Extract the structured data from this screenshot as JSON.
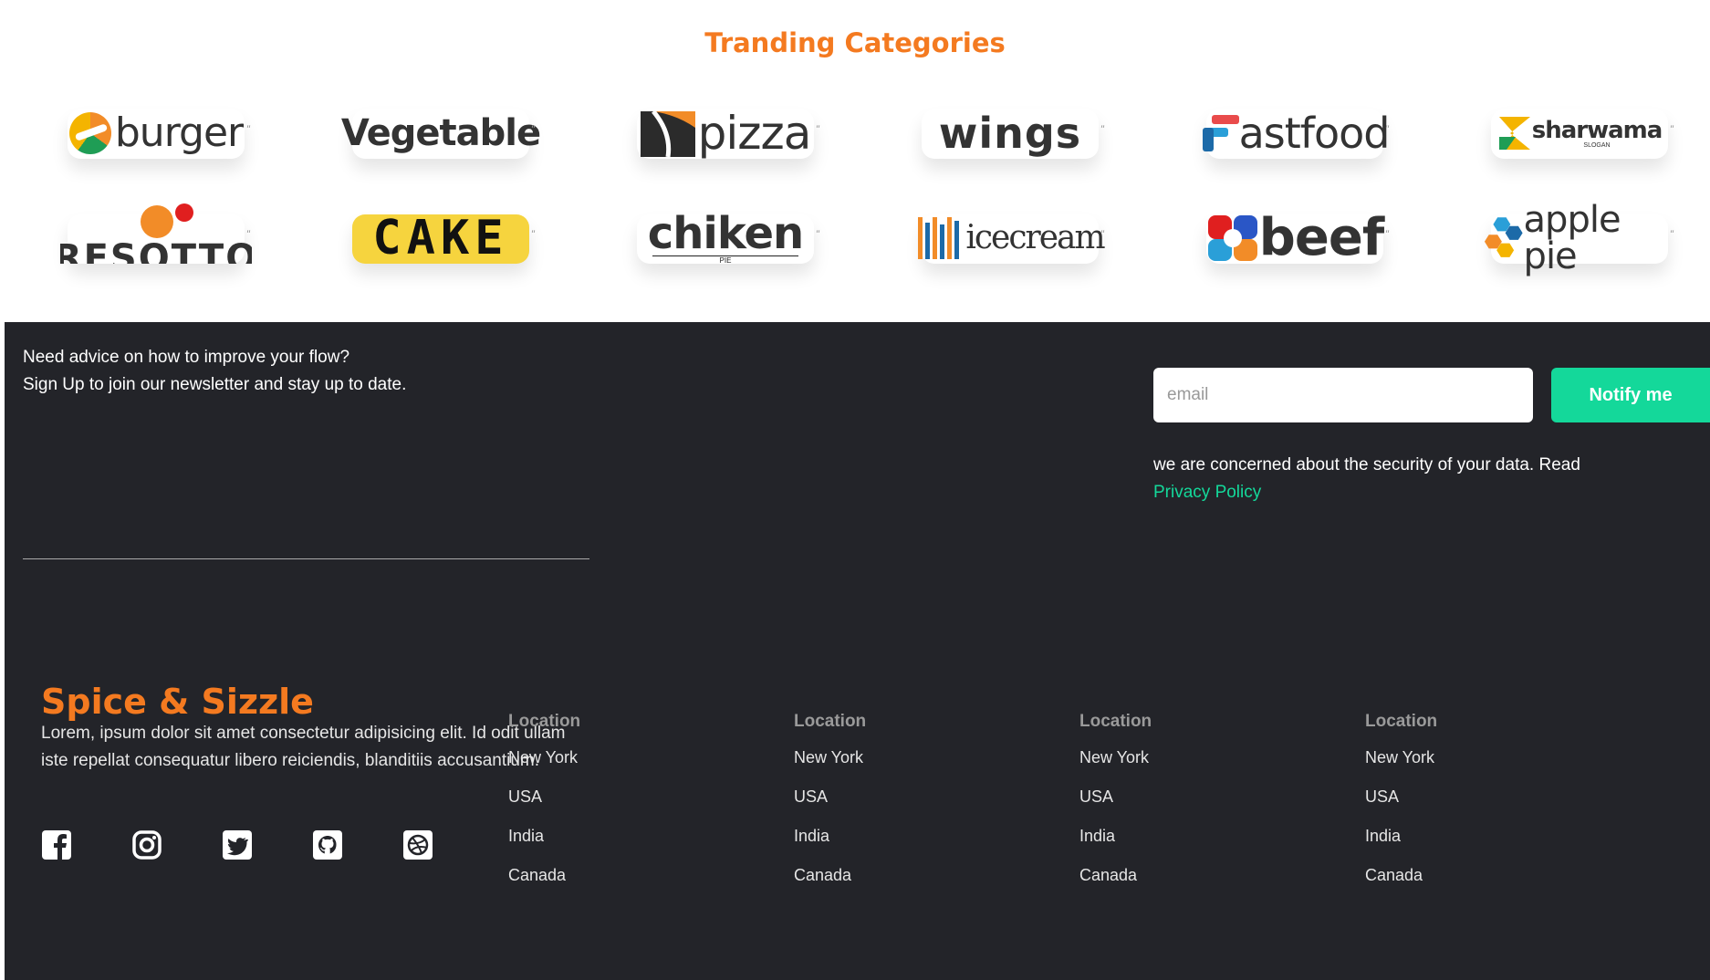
{
  "section_title": "Tranding Categories",
  "categories": [
    {
      "name": "burger",
      "text": "burger",
      "color": "#333333"
    },
    {
      "name": "vegetable",
      "text": "Vegetable",
      "color": "#222222"
    },
    {
      "name": "pizza",
      "text": "pizza",
      "color": "#333333"
    },
    {
      "name": "wings",
      "text": "wings",
      "color": "#333333"
    },
    {
      "name": "fastfood",
      "text": "astfood",
      "color": "#333333"
    },
    {
      "name": "sharwama",
      "text": "sharwama",
      "subtext": "SLOGAN",
      "color": "#333333"
    },
    {
      "name": "resotto",
      "text": "RESOTTO",
      "color": "#333333"
    },
    {
      "name": "cake",
      "text": "CAKE",
      "color": "#111111"
    },
    {
      "name": "chiken",
      "text": "chiken",
      "subtext": "PIE",
      "color": "#222222"
    },
    {
      "name": "icecream",
      "text": "icecream",
      "color": "#333333"
    },
    {
      "name": "beef",
      "text": "beef",
      "color": "#222222"
    },
    {
      "name": "apple-pie",
      "text": "apple pie",
      "color": "#333333"
    }
  ],
  "newsletter": {
    "line1": "Need advice on how to improve your flow?",
    "line2": "Sign Up to join our newsletter and stay up to date.",
    "email_placeholder": "email",
    "button": "Notify me",
    "security_text": "we are concerned about the security of your data. Read",
    "privacy_link": "Privacy Policy"
  },
  "brand": {
    "name": "Spice & Sizzle",
    "description": "Lorem, ipsum dolor sit amet consectetur adipisicing elit. Id odit ullam iste repellat consequatur libero reiciendis, blanditiis accusantium."
  },
  "social_icons": [
    "facebook-icon",
    "instagram-icon",
    "twitter-icon",
    "github-icon",
    "dribbble-icon"
  ],
  "columns": [
    {
      "heading": "Location",
      "links": [
        "New York",
        "USA",
        "India",
        "Canada"
      ]
    },
    {
      "heading": "Location",
      "links": [
        "New York",
        "USA",
        "India",
        "Canada"
      ]
    },
    {
      "heading": "Location",
      "links": [
        "New York",
        "USA",
        "India",
        "Canada"
      ]
    },
    {
      "heading": "Location",
      "links": [
        "New York",
        "USA",
        "India",
        "Canada"
      ]
    }
  ],
  "colors": {
    "accent": "#f47a20",
    "green": "#14d89a",
    "footer_bg": "#232429"
  }
}
